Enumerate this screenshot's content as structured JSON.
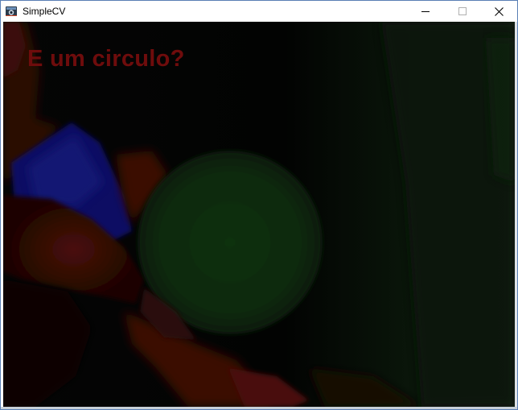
{
  "window": {
    "title": "SimpleCV",
    "app_icon": "simplecv-camera-icon",
    "controls": {
      "minimize_icon": "minimize-icon",
      "maximize_icon": "maximize-icon",
      "close_icon": "close-icon"
    }
  },
  "camera_view": {
    "overlay_text": "E um circulo?",
    "overlay_color": "#6e0c0c"
  }
}
